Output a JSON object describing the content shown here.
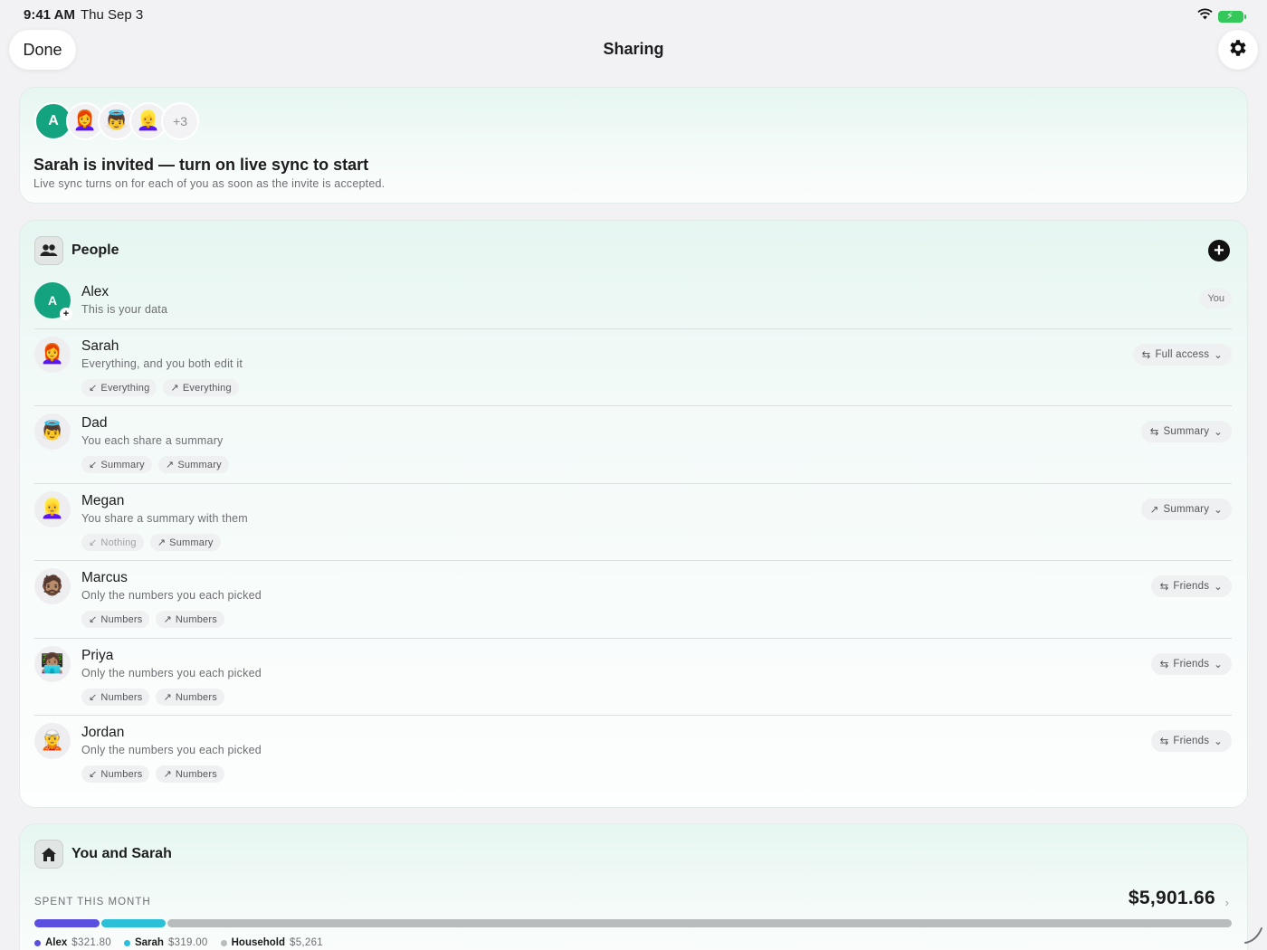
{
  "status_bar": {
    "time": "9:41 AM",
    "date": "Thu Sep 3"
  },
  "nav": {
    "done_label": "Done",
    "title": "Sharing"
  },
  "invite": {
    "avatars": [
      "A",
      "👩‍🦰",
      "👼",
      "👱‍♀️"
    ],
    "more_count": "+3",
    "title": "Sarah is invited — turn on live sync to start",
    "subtitle": "Live sync turns on for each of you as soon as the invite is accepted."
  },
  "people": {
    "title": "People",
    "rows": [
      {
        "name": "Alex",
        "desc": "This is your data",
        "avatar": "A",
        "badge": "You"
      },
      {
        "name": "Sarah",
        "desc": "Everything, and you both edit it",
        "avatar": "👩‍🦰",
        "access": "Full access",
        "in_chip": "Everything",
        "out_chip": "Everything"
      },
      {
        "name": "Dad",
        "desc": "You each share a summary",
        "avatar": "👼",
        "access": "Summary",
        "in_chip": "Summary",
        "out_chip": "Summary"
      },
      {
        "name": "Megan",
        "desc": "You share a summary with them",
        "avatar": "👱‍♀️",
        "access": "Summary",
        "in_chip": "Nothing",
        "out_chip": "Summary"
      },
      {
        "name": "Marcus",
        "desc": "Only the numbers you each picked",
        "avatar": "🧔🏽",
        "access": "Friends",
        "in_chip": "Numbers",
        "out_chip": "Numbers"
      },
      {
        "name": "Priya",
        "desc": "Only the numbers you each picked",
        "avatar": "👩🏽‍💻",
        "access": "Friends",
        "in_chip": "Numbers",
        "out_chip": "Numbers"
      },
      {
        "name": "Jordan",
        "desc": "Only the numbers you each picked",
        "avatar": "🧝",
        "access": "Friends",
        "in_chip": "Numbers",
        "out_chip": "Numbers"
      }
    ]
  },
  "pair": {
    "title": "You and Sarah",
    "spent_label": "SPENT THIS MONTH",
    "spent_total": "$5,901.66",
    "legend": [
      {
        "name": "Alex",
        "value": "$321.80",
        "color": "#5b4fe0",
        "share": 0.0545
      },
      {
        "name": "Sarah",
        "value": "$319.00",
        "color": "#2bbfd8",
        "share": 0.054
      },
      {
        "name": "Household",
        "value": "$5,261",
        "color": "#b9bcbd",
        "share": 0.8915
      }
    ]
  },
  "colors": {
    "accent": "#14a37f",
    "battery": "#34c759"
  }
}
